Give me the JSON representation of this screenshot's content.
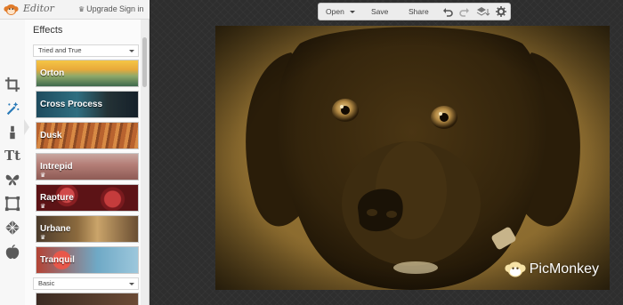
{
  "app": {
    "name": "Editor",
    "upgrade_label": "Upgrade",
    "signin_label": "Sign in"
  },
  "tools": [
    {
      "icon": "crop-icon"
    },
    {
      "icon": "magic-wand-icon"
    },
    {
      "icon": "lipstick-icon"
    },
    {
      "icon": "text-icon",
      "label": "Tt"
    },
    {
      "icon": "butterfly-icon"
    },
    {
      "icon": "frame-icon"
    },
    {
      "icon": "texture-icon"
    },
    {
      "icon": "apple-icon"
    }
  ],
  "panel": {
    "title": "Effects",
    "group1": "Tried and True",
    "group2": "Basic",
    "effects": [
      {
        "label": "Orton",
        "premium": false
      },
      {
        "label": "Cross Process",
        "premium": false
      },
      {
        "label": "Dusk",
        "premium": false
      },
      {
        "label": "Intrepid",
        "premium": true
      },
      {
        "label": "Rapture",
        "premium": true
      },
      {
        "label": "Urbane",
        "premium": true
      },
      {
        "label": "Tranquil",
        "premium": false
      }
    ]
  },
  "toolbar": {
    "open_label": "Open",
    "save_label": "Save",
    "share_label": "Share"
  },
  "watermark": "PicMonkey"
}
